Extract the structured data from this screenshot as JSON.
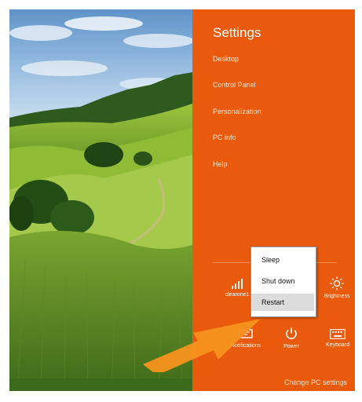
{
  "charms": {
    "title": "Settings",
    "menu": [
      "Desktop",
      "Control Panel",
      "Personalization",
      "PC info",
      "Help"
    ],
    "tiles": {
      "network_label": "clearone1",
      "brightness_label": "Brightness",
      "notifications_label": "Notifications",
      "power_label": "Power",
      "keyboard_label": "Keyboard"
    },
    "change_pc_settings": "Change PC settings",
    "accent_color": "#e95a0c"
  },
  "power_menu": {
    "items": [
      "Sleep",
      "Shut down",
      "Restart"
    ],
    "highlighted": "Restart"
  },
  "annotation": {
    "arrow_color": "#f7941d"
  }
}
